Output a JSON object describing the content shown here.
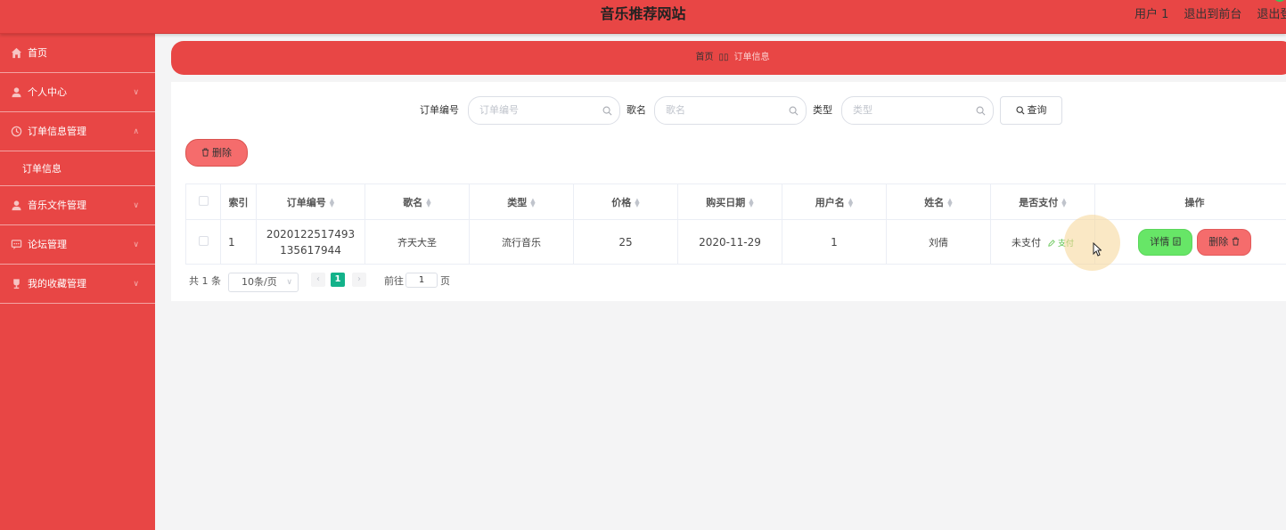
{
  "header": {
    "title": "音乐推荐网站",
    "user_label": "用户 1",
    "back_label": "退出到前台",
    "logout_label": "退出登录"
  },
  "sidebar": {
    "items": [
      {
        "label": "首页",
        "icon": "home-icon"
      },
      {
        "label": "个人中心",
        "icon": "user-icon"
      },
      {
        "label": "订单信息管理",
        "icon": "clock-icon",
        "expanded": true
      },
      {
        "label": "订单信息",
        "icon": ""
      },
      {
        "label": "音乐文件管理",
        "icon": "user-icon"
      },
      {
        "label": "论坛管理",
        "icon": "chat-icon"
      },
      {
        "label": "我的收藏管理",
        "icon": "trophy-icon"
      }
    ]
  },
  "breadcrumb": {
    "home": "首页",
    "separator": "▯▯",
    "current": "订单信息"
  },
  "search": {
    "order_label": "订单编号",
    "order_placeholder": "订单编号",
    "song_label": "歌名",
    "song_placeholder": "歌名",
    "type_label": "类型",
    "type_placeholder": "类型",
    "query_button": "查询"
  },
  "toolbar": {
    "delete_label": "删除"
  },
  "table": {
    "columns": [
      "索引",
      "订单编号",
      "歌名",
      "类型",
      "价格",
      "购买日期",
      "用户名",
      "姓名",
      "是否支付",
      "操作"
    ],
    "rows": [
      {
        "index": "1",
        "order_no": "2020122517493135617944",
        "song": "齐天大圣",
        "type": "流行音乐",
        "price": "25",
        "date": "2020-11-29",
        "username": "1",
        "name": "刘倩",
        "paid": "未支付",
        "pay_link": "支付",
        "detail_label": "详情",
        "delete_label": "删除"
      }
    ]
  },
  "pagination": {
    "total": "共 1 条",
    "page_size": "10条/页",
    "current_page": "1",
    "goto_label": "前往",
    "goto_value": "1",
    "page_unit": "页"
  },
  "colors": {
    "primary": "#e84645",
    "success": "#67e667",
    "danger": "#f56c6c",
    "page_active": "#13b28a"
  }
}
